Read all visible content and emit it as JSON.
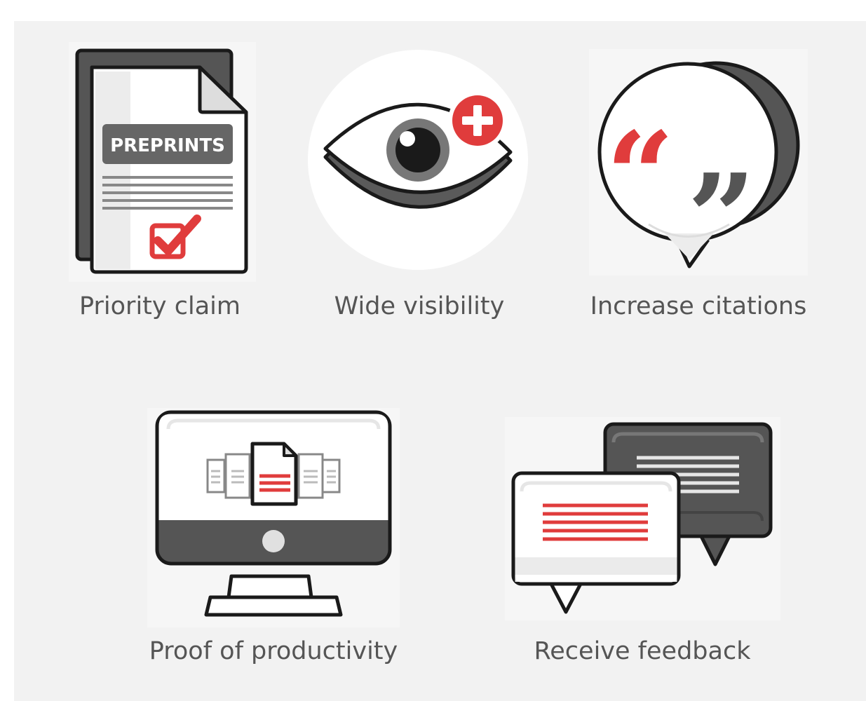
{
  "benefits": [
    {
      "caption": "Priority claim",
      "icon": "preprint-document-icon",
      "badge": "PREPRINTS"
    },
    {
      "caption": "Wide visibility",
      "icon": "eye-plus-icon"
    },
    {
      "caption": "Increase citations",
      "icon": "quote-bubble-icon"
    },
    {
      "caption": "Proof of productivity",
      "icon": "monitor-documents-icon"
    },
    {
      "caption": "Receive feedback",
      "icon": "chat-bubbles-icon"
    }
  ],
  "colors": {
    "accent": "#e03c3c",
    "dark": "#555555",
    "outline": "#1a1a1a",
    "panel": "#f2f2f2",
    "tile": "#f6f6f6"
  }
}
